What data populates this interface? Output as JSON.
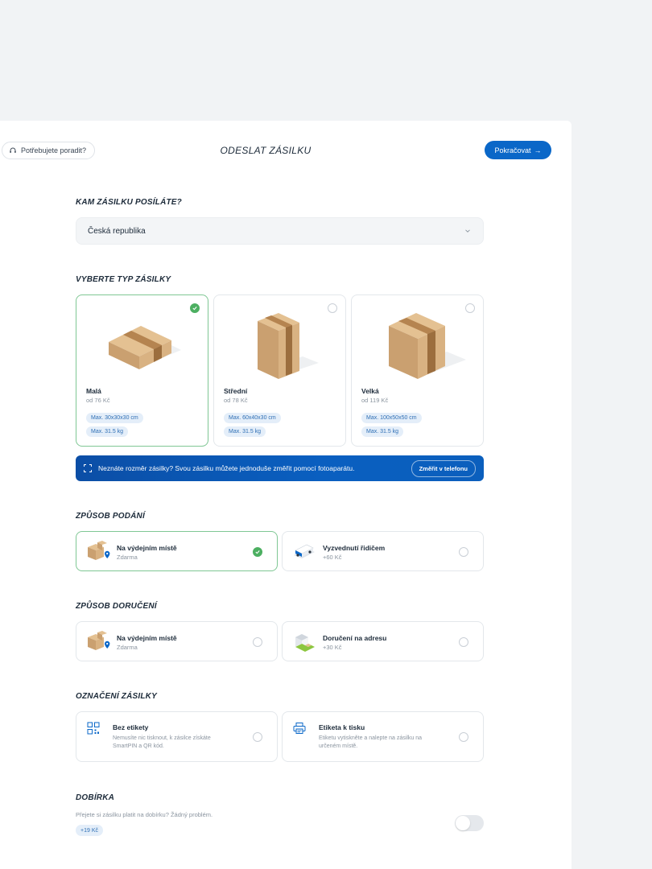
{
  "header": {
    "help_label": "Potřebujete poradit?",
    "title": "ODESLAT ZÁSILKU",
    "continue_label": "Pokračovat",
    "continue_arrow": "→"
  },
  "destination": {
    "heading": "KAM ZÁSILKU POSÍLÁTE?",
    "selected_value": "Česká republika"
  },
  "package_type": {
    "heading": "VYBERTE TYP ZÁSILKY",
    "options": [
      {
        "name": "Malá",
        "price": "od 76 Kč",
        "dims": "Max. 30x30x30 cm",
        "weight": "Max. 31.5 kg",
        "selected": true
      },
      {
        "name": "Střední",
        "price": "od 78 Kč",
        "dims": "Max. 60x40x30 cm",
        "weight": "Max. 31.5 kg",
        "selected": false
      },
      {
        "name": "Velká",
        "price": "od 119 Kč",
        "dims": "Max. 100x50x50 cm",
        "weight": "Max. 31.5 kg",
        "selected": false
      }
    ]
  },
  "measure_banner": {
    "text": "Neznáte rozměr zásilky? Svou zásilku můžete jednoduše změřit pomocí fotoaparátu.",
    "button_label": "Změřit v telefonu"
  },
  "submission": {
    "heading": "ZPŮSOB PODÁNÍ",
    "options": [
      {
        "title": "Na výdejním místě",
        "sub": "Zdarma",
        "selected": true
      },
      {
        "title": "Vyzvednutí řidičem",
        "sub": "+60 Kč",
        "selected": false
      }
    ]
  },
  "delivery": {
    "heading": "ZPŮSOB DORUČENÍ",
    "options": [
      {
        "title": "Na výdejním místě",
        "sub": "Zdarma",
        "selected": false
      },
      {
        "title": "Doručení na adresu",
        "sub": "+30 Kč",
        "selected": false
      }
    ]
  },
  "labeling": {
    "heading": "OZNAČENÍ ZÁSILKY",
    "options": [
      {
        "title": "Bez etikety",
        "desc": "Nemusíte nic tisknout, k zásilce získáte SmartPIN a QR kód.",
        "icon": "qr-code-icon",
        "selected": false
      },
      {
        "title": "Etiketa k tisku",
        "desc": "Etiketu vytiskněte a nalepte na zásilku na určeném místě.",
        "icon": "printer-icon",
        "selected": false
      }
    ]
  },
  "cod": {
    "heading": "DOBÍRKA",
    "text": "Přejete si zásilku platit na dobírku? Žádný problém.",
    "price": "+19 Kč",
    "enabled": false
  },
  "colors": {
    "primary": "#0a67c8",
    "success": "#4caf61",
    "chip_bg": "#e4eef9",
    "chip_text": "#2f6fb5"
  }
}
